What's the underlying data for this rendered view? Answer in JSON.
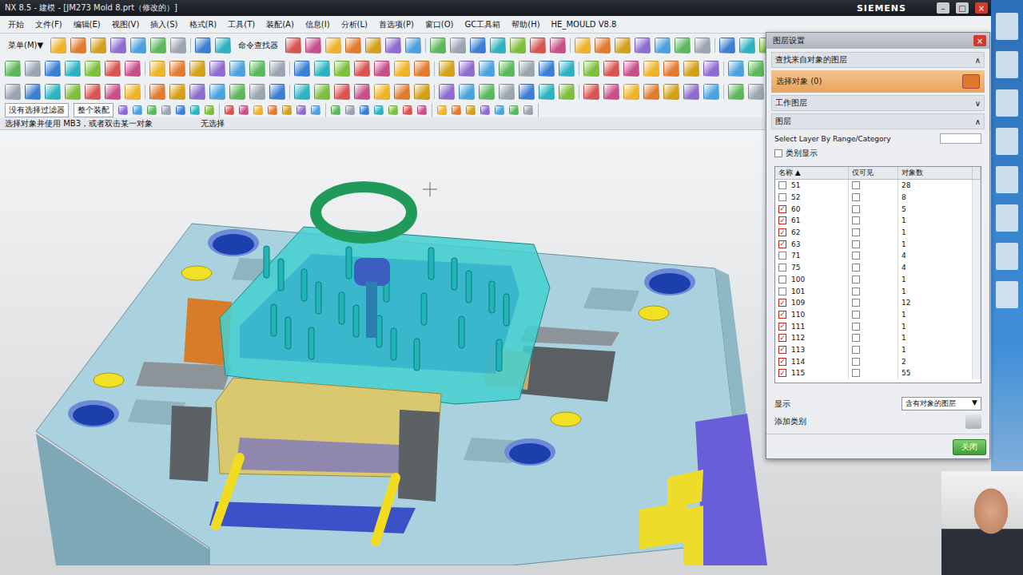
{
  "window": {
    "title": "NX 8.5 - 建模 - [JM273 Mold 8.prt（修改的）]",
    "brand": "SIEMENS",
    "controls": [
      "–",
      "□",
      "×"
    ]
  },
  "menu": [
    "开始",
    "文件(F)",
    "编辑(E)",
    "视图(V)",
    "插入(S)",
    "格式(R)",
    "工具(T)",
    "装配(A)",
    "信息(I)",
    "分析(L)",
    "首选项(P)",
    "窗口(O)",
    "GC工具箱",
    "帮助(H)",
    "HE_MOULD V8.8"
  ],
  "toolbar": {
    "menu_button": "菜单(M)▼",
    "finder": "命令查找器",
    "filter": "没有选择过滤器",
    "scope": "整个装配"
  },
  "status": {
    "prompt": "选择对象并使用 MB3，或者双击某一对象",
    "right": "无选择"
  },
  "dialog": {
    "title": "图层设置",
    "close": "×",
    "find_section": {
      "label": "查找来自对象的图层",
      "expanded": true,
      "arrow": "∧"
    },
    "select_object": "选择对象 (0)",
    "work_section": {
      "label": "工作图层",
      "expanded": false,
      "arrow": "∨"
    },
    "layer_section": {
      "label": "图层",
      "expanded": true,
      "arrow": "∧"
    },
    "range_label": "Select Layer By Range/Category",
    "category_display": {
      "label": "类别显示",
      "checked": false
    },
    "columns": [
      "名称 ▲",
      "仅可见",
      "对象数"
    ],
    "rows": [
      {
        "name": "51",
        "checked": false,
        "only_visible": false,
        "count": "28"
      },
      {
        "name": "52",
        "checked": false,
        "only_visible": false,
        "count": "8"
      },
      {
        "name": "60",
        "checked": true,
        "only_visible": false,
        "count": "5"
      },
      {
        "name": "61",
        "checked": true,
        "only_visible": false,
        "count": "1"
      },
      {
        "name": "62",
        "checked": true,
        "only_visible": false,
        "count": "1"
      },
      {
        "name": "63",
        "checked": true,
        "only_visible": false,
        "count": "1"
      },
      {
        "name": "71",
        "checked": false,
        "only_visible": false,
        "count": "4"
      },
      {
        "name": "75",
        "checked": false,
        "only_visible": false,
        "count": "4"
      },
      {
        "name": "100",
        "checked": false,
        "only_visible": false,
        "count": "1"
      },
      {
        "name": "101",
        "checked": false,
        "only_visible": false,
        "count": "1"
      },
      {
        "name": "109",
        "checked": true,
        "only_visible": false,
        "count": "12"
      },
      {
        "name": "110",
        "checked": true,
        "only_visible": false,
        "count": "1"
      },
      {
        "name": "111",
        "checked": true,
        "only_visible": false,
        "count": "1"
      },
      {
        "name": "112",
        "checked": true,
        "only_visible": false,
        "count": "1"
      },
      {
        "name": "113",
        "checked": true,
        "only_visible": false,
        "count": "1"
      },
      {
        "name": "114",
        "checked": true,
        "only_visible": false,
        "count": "2"
      },
      {
        "name": "115",
        "checked": true,
        "only_visible": false,
        "count": "55"
      }
    ],
    "show_label": "显示",
    "show_value": "含有对象的图层",
    "show_arrow": "▼",
    "add_category": "添加类别",
    "close_button": "关闭"
  }
}
